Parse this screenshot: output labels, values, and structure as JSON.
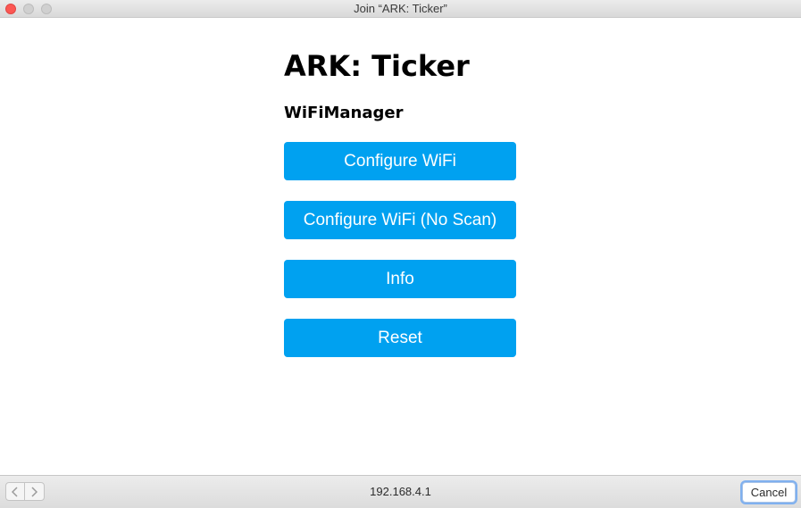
{
  "window": {
    "title": "Join “ARK: Ticker”"
  },
  "page": {
    "title": "ARK: Ticker",
    "subtitle": "WiFiManager"
  },
  "buttons": [
    {
      "label": "Configure WiFi"
    },
    {
      "label": "Configure WiFi (No Scan)"
    },
    {
      "label": "Info"
    },
    {
      "label": "Reset"
    }
  ],
  "bottombar": {
    "url": "192.168.4.1",
    "cancel_label": "Cancel"
  },
  "colors": {
    "button_bg": "#00a1f0",
    "close_light": "#fc5753"
  }
}
